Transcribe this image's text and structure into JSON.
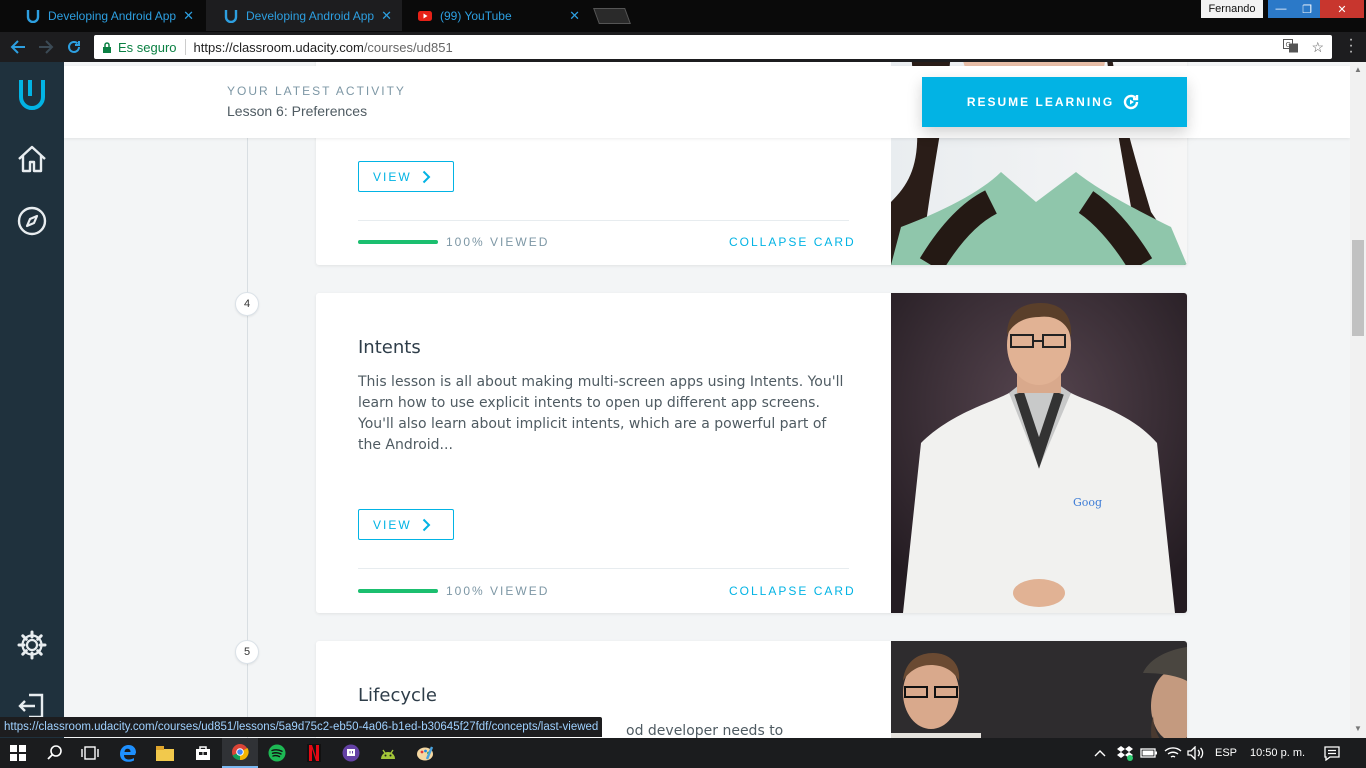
{
  "browser": {
    "tabs": [
      {
        "title": "Developing Android App",
        "icon": "udacity-icon",
        "active": false
      },
      {
        "title": "Developing Android App",
        "icon": "udacity-icon",
        "active": true
      },
      {
        "title": "(99) YouTube",
        "icon": "youtube-icon",
        "active": false
      }
    ],
    "profile_name": "Fernando",
    "security_label": "Es seguro",
    "url_host": "https://classroom.udacity.com",
    "url_path": "/courses/ud851"
  },
  "header": {
    "activity_label": "YOUR LATEST ACTIVITY",
    "latest_lesson": "Lesson 6: Preferences",
    "resume_label": "RESUME LEARNING"
  },
  "lessons": [
    {
      "view_label": "VIEW",
      "progress_percent": 100,
      "progress_text": "100% VIEWED",
      "collapse_label": "COLLAPSE CARD"
    },
    {
      "number": "4",
      "title": "Intents",
      "description": "This lesson is all about making multi-screen apps using Intents. You'll learn how to use explicit intents to open up different app screens. You'll also learn about implicit intents, which are a powerful part of the Android...",
      "view_label": "VIEW",
      "progress_percent": 100,
      "progress_text": "100% VIEWED",
      "collapse_label": "COLLAPSE CARD"
    },
    {
      "number": "5",
      "title": "Lifecycle",
      "description_visible": "od developer needs to"
    }
  ],
  "status_url": "https://classroom.udacity.com/courses/ud851/lessons/5a9d75c2-eb50-4a06-b1ed-b30645f27fdf/concepts/last-viewed",
  "taskbar": {
    "language": "ESP",
    "clock": "10:50 p. m."
  },
  "colors": {
    "accent": "#02b3e4",
    "progress": "#1bbf6f",
    "sidebar": "#1f313d",
    "tab_text": "#2d9fe0"
  }
}
